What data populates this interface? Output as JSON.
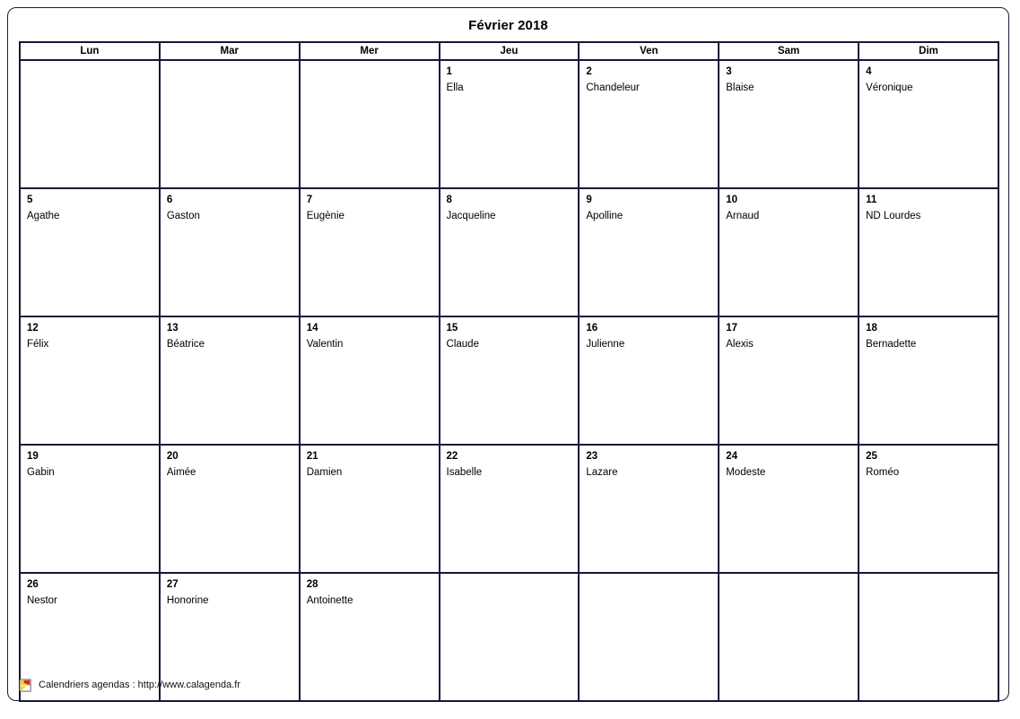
{
  "title": "Février 2018",
  "weekday_headers": [
    "Lun",
    "Mar",
    "Mer",
    "Jeu",
    "Ven",
    "Sam",
    "Dim"
  ],
  "footer": {
    "logo_icon": "calagenda-flag-icon",
    "text": "Calendriers agendas : http://www.calagenda.fr"
  },
  "colors": {
    "grid_border": "#161638",
    "frame_border": "#1c1c3c",
    "text": "#000000",
    "background": "#ffffff",
    "logo_yellow": "#f5d020",
    "logo_red": "#e02020"
  },
  "weeks": [
    [
      {
        "num": "",
        "name": "",
        "empty": true
      },
      {
        "num": "",
        "name": "",
        "empty": true
      },
      {
        "num": "",
        "name": "",
        "empty": true
      },
      {
        "num": "1",
        "name": "Ella",
        "empty": false
      },
      {
        "num": "2",
        "name": "Chandeleur",
        "empty": false
      },
      {
        "num": "3",
        "name": "Blaise",
        "empty": false
      },
      {
        "num": "4",
        "name": "Véronique",
        "empty": false
      }
    ],
    [
      {
        "num": "5",
        "name": "Agathe",
        "empty": false
      },
      {
        "num": "6",
        "name": "Gaston",
        "empty": false
      },
      {
        "num": "7",
        "name": "Eugènie",
        "empty": false
      },
      {
        "num": "8",
        "name": "Jacqueline",
        "empty": false
      },
      {
        "num": "9",
        "name": "Apolline",
        "empty": false
      },
      {
        "num": "10",
        "name": "Arnaud",
        "empty": false
      },
      {
        "num": "11",
        "name": "ND Lourdes",
        "empty": false
      }
    ],
    [
      {
        "num": "12",
        "name": "Félix",
        "empty": false
      },
      {
        "num": "13",
        "name": "Béatrice",
        "empty": false
      },
      {
        "num": "14",
        "name": "Valentin",
        "empty": false
      },
      {
        "num": "15",
        "name": "Claude",
        "empty": false
      },
      {
        "num": "16",
        "name": "Julienne",
        "empty": false
      },
      {
        "num": "17",
        "name": "Alexis",
        "empty": false
      },
      {
        "num": "18",
        "name": "Bernadette",
        "empty": false
      }
    ],
    [
      {
        "num": "19",
        "name": "Gabin",
        "empty": false
      },
      {
        "num": "20",
        "name": "Aimée",
        "empty": false
      },
      {
        "num": "21",
        "name": "Damien",
        "empty": false
      },
      {
        "num": "22",
        "name": "Isabelle",
        "empty": false
      },
      {
        "num": "23",
        "name": "Lazare",
        "empty": false
      },
      {
        "num": "24",
        "name": "Modeste",
        "empty": false
      },
      {
        "num": "25",
        "name": "Roméo",
        "empty": false
      }
    ],
    [
      {
        "num": "26",
        "name": "Nestor",
        "empty": false
      },
      {
        "num": "27",
        "name": "Honorine",
        "empty": false
      },
      {
        "num": "28",
        "name": "Antoinette",
        "empty": false
      },
      {
        "num": "",
        "name": "",
        "empty": true
      },
      {
        "num": "",
        "name": "",
        "empty": true
      },
      {
        "num": "",
        "name": "",
        "empty": true
      },
      {
        "num": "",
        "name": "",
        "empty": true
      }
    ]
  ]
}
